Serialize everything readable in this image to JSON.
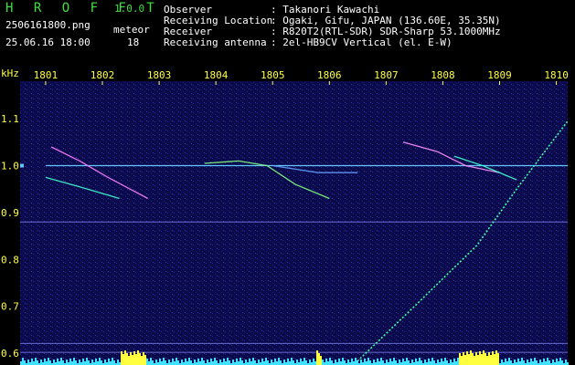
{
  "app": {
    "title": "H R O F F T",
    "version": "1.0.0",
    "filename": "2506161800.png",
    "datetime": "25.06.16 18:00",
    "meteor_label": "meteor",
    "meteor_count": "18"
  },
  "info": {
    "labels": [
      "Observer",
      "Receiving Location",
      "Receiver",
      "Receiving antenna"
    ],
    "values": [
      ": Takanori Kawachi",
      ": Ogaki, Gifu, JAPAN (136.60E, 35.35N)",
      ": R820T2(RTL-SDR) SDR-Sharp 53.1000MHz",
      ": 2el-HB9CV Vertical (el. E-W)"
    ]
  },
  "chart_data": {
    "type": "heatmap",
    "yunit": "kHz",
    "x_ticks": [
      "1801",
      "1802",
      "1803",
      "1804",
      "1805",
      "1806",
      "1807",
      "1808",
      "1809",
      "1810"
    ],
    "y_ticks": [
      "1.1",
      "1.0",
      "0.9",
      "0.8",
      "0.7",
      "0.6"
    ],
    "ylim": [
      0.575,
      1.18
    ],
    "xlim": [
      1800.55,
      1810.2
    ],
    "carrier_khz": 1.0,
    "interference_lines_khz": [
      0.88,
      0.621,
      0.602
    ],
    "meteor_traces": [
      [
        [
          1801.1,
          1.04
        ],
        [
          1801.6,
          1.01
        ],
        [
          1802.1,
          0.975
        ],
        [
          1802.8,
          0.93
        ]
      ],
      [
        [
          1801.0,
          0.975
        ],
        [
          1801.6,
          0.955
        ],
        [
          1802.3,
          0.93
        ]
      ],
      [
        [
          1803.8,
          1.005
        ],
        [
          1804.4,
          1.01
        ],
        [
          1804.9,
          1.0
        ],
        [
          1805.4,
          0.96
        ],
        [
          1806.0,
          0.93
        ]
      ],
      [
        [
          1805.0,
          1.0
        ],
        [
          1805.8,
          0.985
        ],
        [
          1806.5,
          0.985
        ]
      ],
      [
        [
          1807.3,
          1.05
        ],
        [
          1807.9,
          1.03
        ],
        [
          1808.4,
          1.0
        ],
        [
          1809.0,
          0.985
        ]
      ],
      [
        [
          1808.2,
          1.02
        ],
        [
          1808.7,
          1.0
        ],
        [
          1809.3,
          0.97
        ]
      ]
    ],
    "drift_trace": [
      [
        1806.45,
        0.578
      ],
      [
        1807.5,
        0.7
      ],
      [
        1808.6,
        0.83
      ],
      [
        1809.3,
        0.95
      ],
      [
        1810.2,
        1.095
      ]
    ],
    "colors": {
      "background": "#000000",
      "plot_bg": "#0b0a4a",
      "axis_text": "#ffff40",
      "carrier": "#60c8ff",
      "title": "#3fe03f"
    }
  }
}
